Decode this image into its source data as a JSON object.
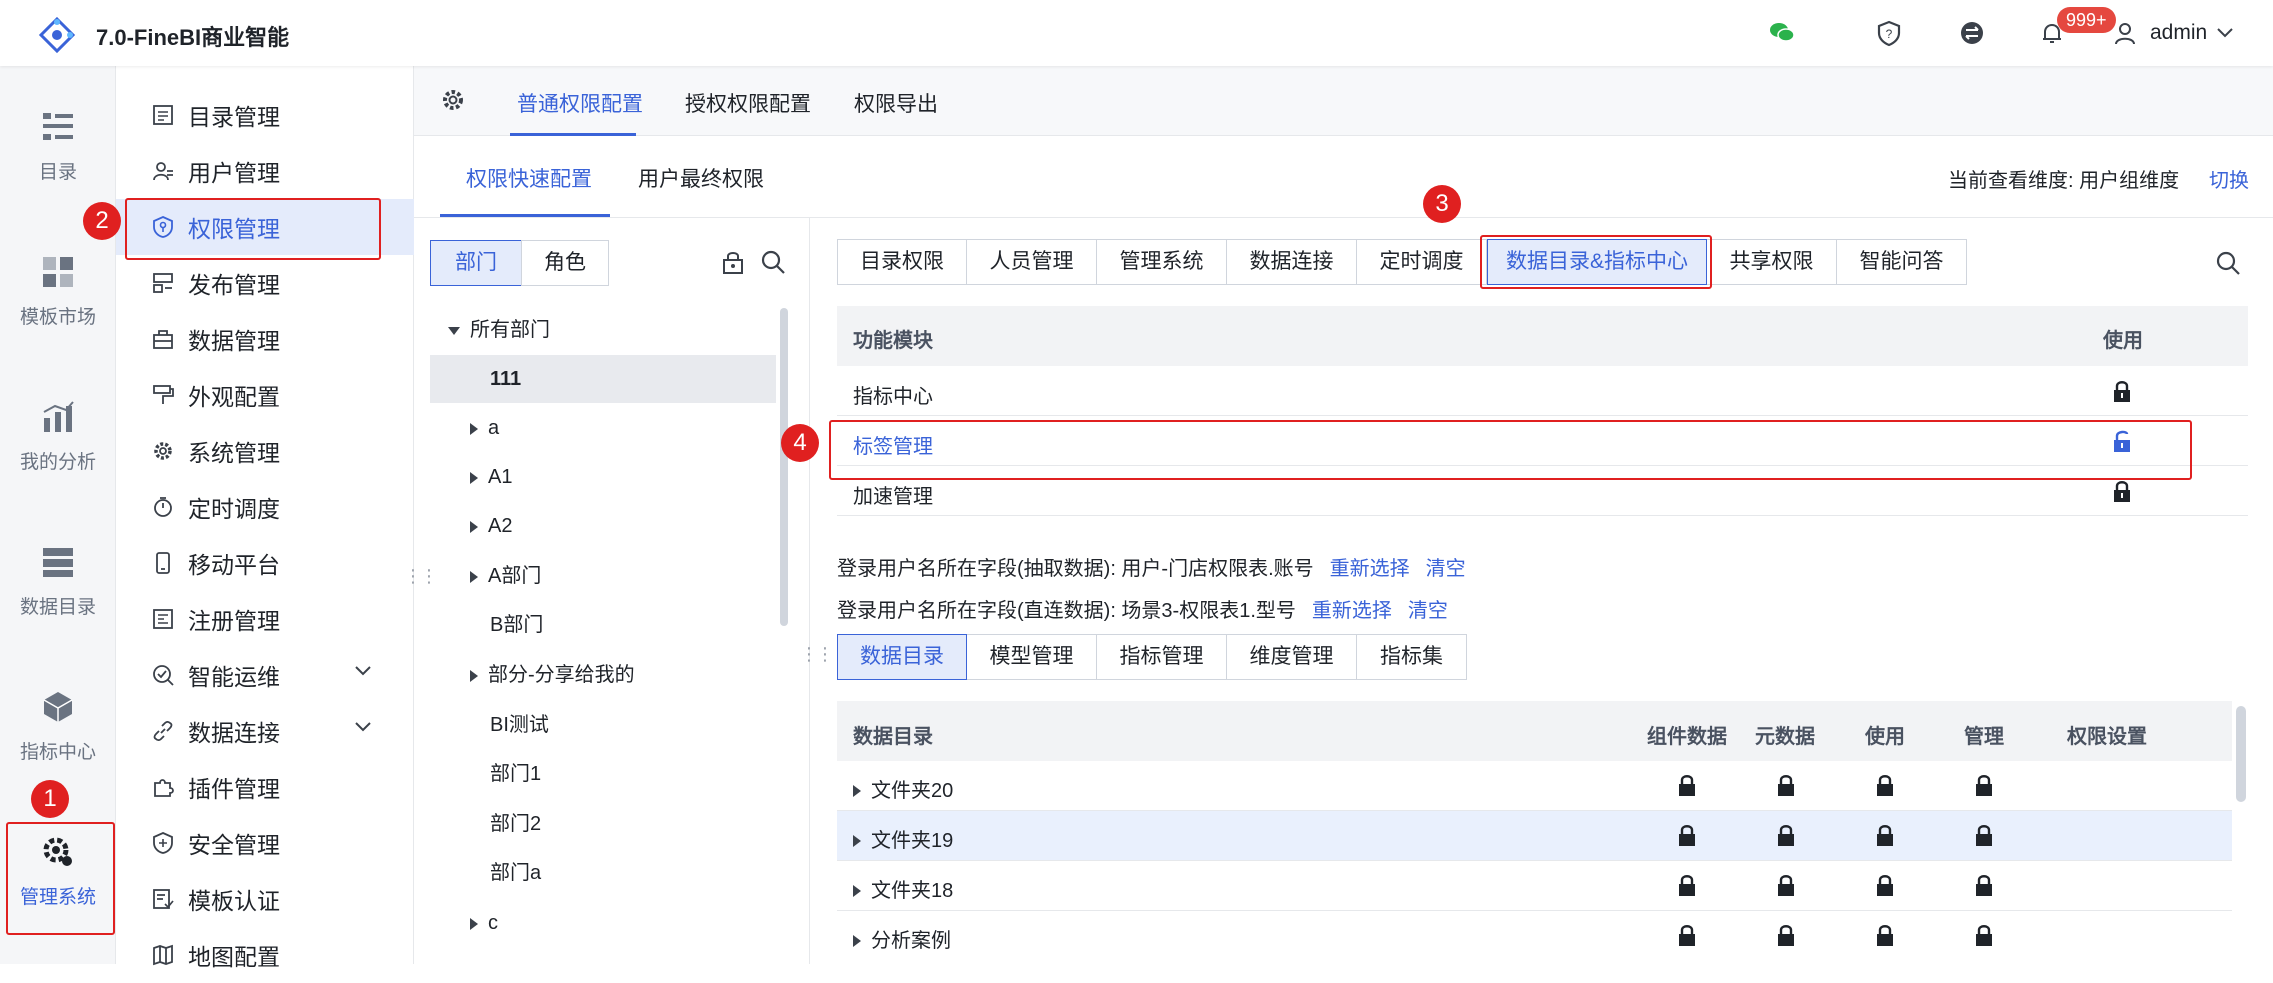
{
  "app": {
    "title": "7.0-FineBI商业智能",
    "badge": "999+",
    "user": "admin"
  },
  "colors": {
    "accent": "#3a63d8",
    "highlight": "#e02020",
    "active_bg": "#e4ebfb"
  },
  "rail": [
    {
      "label": "目录",
      "icon": "catalog-icon"
    },
    {
      "label": "模板市场",
      "icon": "template-market-icon"
    },
    {
      "label": "我的分析",
      "icon": "analysis-icon"
    },
    {
      "label": "数据目录",
      "icon": "data-catalog-icon"
    },
    {
      "label": "指标中心",
      "icon": "metric-center-icon"
    },
    {
      "label": "管理系统",
      "icon": "admin-system-icon"
    }
  ],
  "menu": [
    {
      "label": "目录管理"
    },
    {
      "label": "用户管理"
    },
    {
      "label": "权限管理"
    },
    {
      "label": "发布管理"
    },
    {
      "label": "数据管理"
    },
    {
      "label": "外观配置"
    },
    {
      "label": "系统管理"
    },
    {
      "label": "定时调度"
    },
    {
      "label": "移动平台"
    },
    {
      "label": "注册管理"
    },
    {
      "label": "智能运维"
    },
    {
      "label": "数据连接"
    },
    {
      "label": "插件管理"
    },
    {
      "label": "安全管理"
    },
    {
      "label": "模板认证"
    },
    {
      "label": "地图配置"
    }
  ],
  "tabs_top": [
    "普通权限配置",
    "授权权限配置",
    "权限导出"
  ],
  "tabs_second": [
    "权限快速配置",
    "用户最终权限"
  ],
  "dimension": {
    "label": "当前查看维度:  用户组维度",
    "switch": "切换"
  },
  "segments": [
    "部门",
    "角色"
  ],
  "tree": [
    "所有部门",
    "111",
    "a",
    "A1",
    "A2",
    "A部门",
    "B部门",
    "部分-分享给我的",
    "BI测试",
    "部门1",
    "部门2",
    "部门a",
    "c"
  ],
  "categories": [
    "目录权限",
    "人员管理",
    "管理系统",
    "数据连接",
    "定时调度",
    "数据目录&指标中心",
    "共享权限",
    "智能问答"
  ],
  "module_table": {
    "headers": [
      "功能模块",
      "使用"
    ],
    "rows": [
      {
        "name": "指标中心"
      },
      {
        "name": "标签管理"
      },
      {
        "name": "加速管理"
      }
    ]
  },
  "fields": [
    {
      "text": "登录用户名所在字段(抽取数据): 用户-门店权限表.账号",
      "reselect": "重新选择",
      "clear": "清空"
    },
    {
      "text": "登录用户名所在字段(直连数据): 场景3-权限表1.型号",
      "reselect": "重新选择",
      "clear": "清空"
    }
  ],
  "sub_tabs": [
    "数据目录",
    "模型管理",
    "指标管理",
    "维度管理",
    "指标集"
  ],
  "data_table": {
    "headers": [
      "数据目录",
      "组件数据",
      "元数据",
      "使用",
      "管理",
      "权限设置"
    ],
    "rows": [
      "文件夹20",
      "文件夹19",
      "文件夹18",
      "分析案例"
    ]
  },
  "markers": [
    "1",
    "2",
    "3",
    "4"
  ]
}
